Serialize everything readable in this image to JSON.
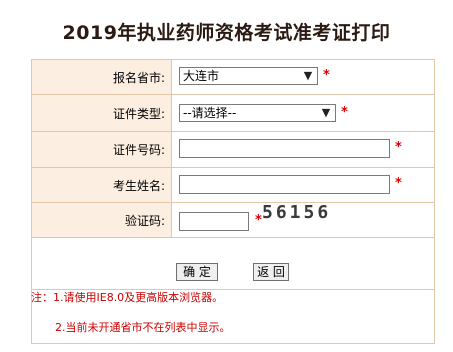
{
  "page": {
    "title": "2019年执业药师资格考试准考证打印"
  },
  "form": {
    "province": {
      "label": "报名省市:",
      "selected": "大连市"
    },
    "id_type": {
      "label": "证件类型:",
      "selected": "--请选择--"
    },
    "id_number": {
      "label": "证件号码:",
      "value": ""
    },
    "name": {
      "label": "考生姓名:",
      "value": ""
    },
    "captcha": {
      "label": "验证码:",
      "value": "",
      "image_text": "56156"
    },
    "required_mark": "*"
  },
  "buttons": {
    "confirm": "确 定",
    "back": "返 回"
  },
  "notes": {
    "line1": "注：1.请使用IE8.0及更高版本浏览器。",
    "line2": "2.当前未开通省市不在列表中显示。"
  },
  "colors": {
    "label_bg": "#fcefe2",
    "border": "#e3c7a8",
    "required": "#e00000"
  }
}
